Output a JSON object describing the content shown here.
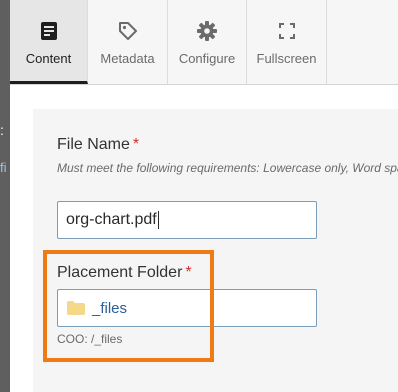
{
  "background_peek": {
    "char1": ":",
    "char2": "fi"
  },
  "tabs": [
    {
      "label": "Content",
      "icon": "document-icon",
      "active": true
    },
    {
      "label": "Metadata",
      "icon": "tag-icon",
      "active": false
    },
    {
      "label": "Configure",
      "icon": "gear-icon",
      "active": false
    },
    {
      "label": "Fullscreen",
      "icon": "expand-icon",
      "active": false
    }
  ],
  "form": {
    "file_name": {
      "label": "File Name",
      "required_mark": "*",
      "hint": "Must meet the following requirements: Lowercase only, Word spa",
      "value": "org-chart.pdf"
    },
    "placement_folder": {
      "label": "Placement Folder",
      "required_mark": "*",
      "value": "_files",
      "icon": "folder-icon",
      "path_note": "COO: /_files"
    }
  },
  "colors": {
    "highlight": "#f07b14",
    "required": "#d0312d",
    "link": "#2a5f97",
    "folder": "#f5d98b"
  }
}
